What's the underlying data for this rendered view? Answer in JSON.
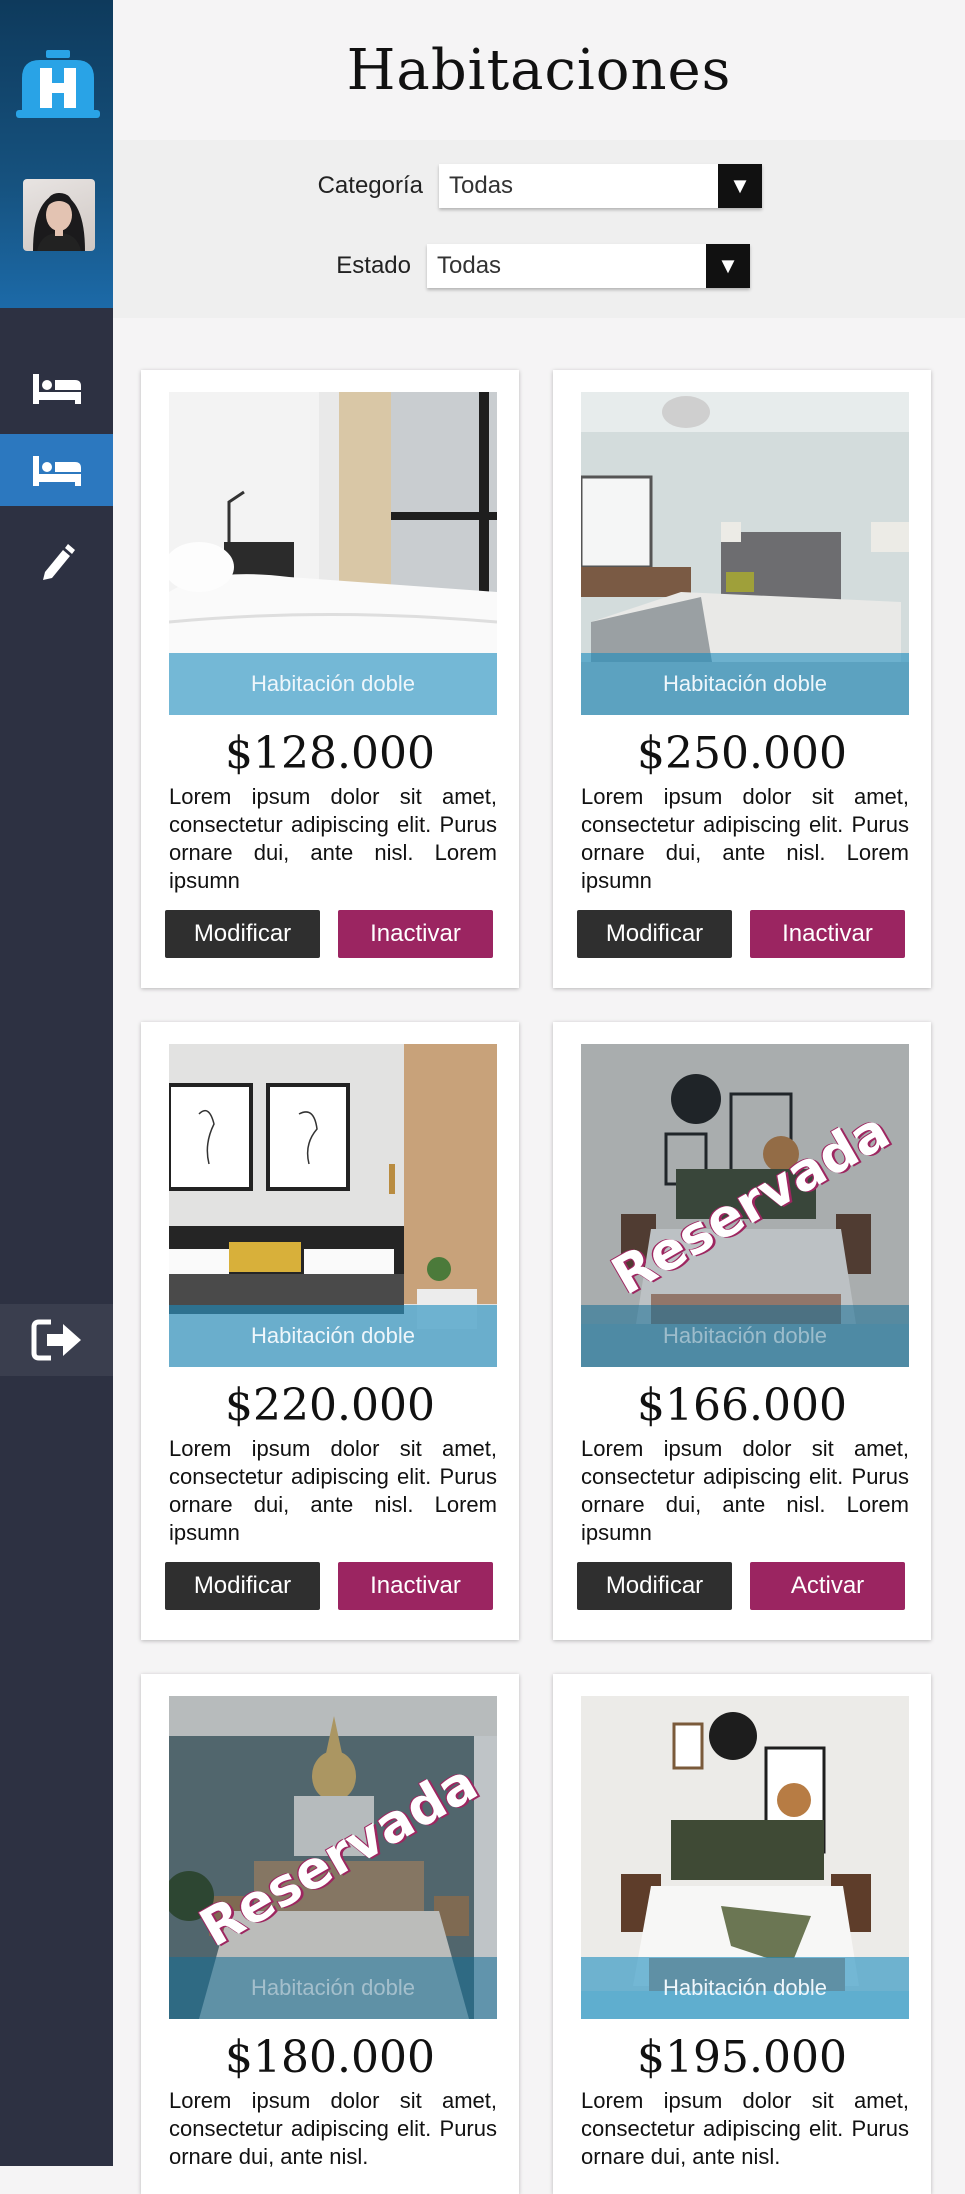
{
  "page": {
    "title": "Habitaciones"
  },
  "sidebar": {
    "logo_icon": "hotel-logo-icon",
    "avatar_icon": "user-avatar",
    "nav": [
      {
        "icon": "bed-icon",
        "active": false
      },
      {
        "icon": "bed-icon",
        "active": true
      },
      {
        "icon": "pencil-icon",
        "active": false
      }
    ],
    "logout_icon": "logout-icon"
  },
  "filters": {
    "category": {
      "label": "Categoría",
      "value": "Todas"
    },
    "status": {
      "label": "Estado",
      "value": "Todas"
    }
  },
  "rooms": [
    {
      "price": "$128.000",
      "caption": "Habitación doble",
      "description": "Lorem ipsum dolor sit amet, consectetur adipiscing elit. Purus ornare dui, ante nisl. Lorem ipsumn",
      "modify_label": "Modificar",
      "action_label": "Inactivar",
      "stamp": ""
    },
    {
      "price": "$250.000",
      "caption": "Habitación doble",
      "description": "Lorem ipsum dolor sit amet, consectetur adipiscing elit. Purus ornare dui, ante nisl. Lorem ipsumn",
      "modify_label": "Modificar",
      "action_label": "Inactivar",
      "stamp": ""
    },
    {
      "price": "$220.000",
      "caption": "Habitación doble",
      "description": "Lorem ipsum dolor sit amet, consectetur adipiscing elit. Purus ornare dui, ante nisl. Lorem ipsumn",
      "modify_label": "Modificar",
      "action_label": "Inactivar",
      "stamp": ""
    },
    {
      "price": "$166.000",
      "caption": "Habitación doble",
      "description": "Lorem ipsum dolor sit amet, consectetur adipiscing elit. Purus ornare dui, ante nisl. Lorem ipsumn",
      "modify_label": "Modificar",
      "action_label": "Activar",
      "stamp": "Reservada"
    },
    {
      "price": "$180.000",
      "caption": "Habitación doble",
      "description": "Lorem ipsum dolor sit amet, consectetur adipiscing elit. Purus ornare dui, ante nisl.",
      "stamp": "Reservada"
    },
    {
      "price": "$195.000",
      "caption": "Habitación doble",
      "description": "Lorem ipsum dolor sit amet, consectetur adipiscing elit. Purus ornare dui, ante nisl.",
      "stamp": ""
    }
  ],
  "colors": {
    "sidebar": "#2d3142",
    "active": "#2c78bf",
    "accent": "#9b2561",
    "dark_button": "#2f2f2f"
  }
}
